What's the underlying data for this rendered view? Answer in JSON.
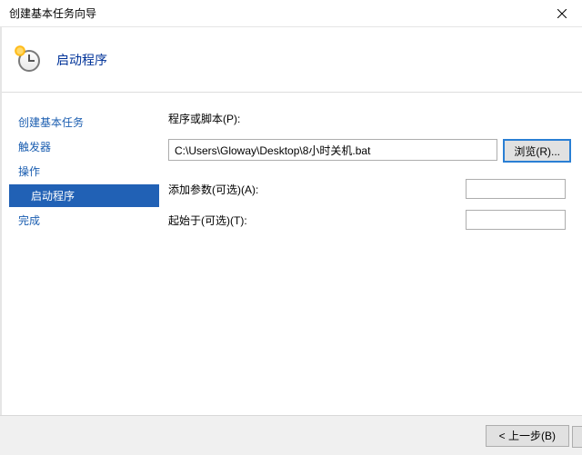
{
  "window": {
    "title": "创建基本任务向导"
  },
  "header": {
    "title": "启动程序"
  },
  "sidebar": {
    "items": [
      {
        "label": "创建基本任务",
        "indent": false,
        "selected": false
      },
      {
        "label": "触发器",
        "indent": false,
        "selected": false
      },
      {
        "label": "操作",
        "indent": false,
        "selected": false
      },
      {
        "label": "启动程序",
        "indent": true,
        "selected": true
      },
      {
        "label": "完成",
        "indent": false,
        "selected": false
      }
    ]
  },
  "main": {
    "script_label": "程序或脚本(P):",
    "script_value": "C:\\Users\\Gloway\\Desktop\\8小时关机.bat",
    "browse_label": "浏览(R)...",
    "args_label": "添加参数(可选)(A):",
    "args_value": "",
    "startin_label": "起始于(可选)(T):",
    "startin_value": ""
  },
  "footer": {
    "back_label": "< 上一步(B)"
  }
}
